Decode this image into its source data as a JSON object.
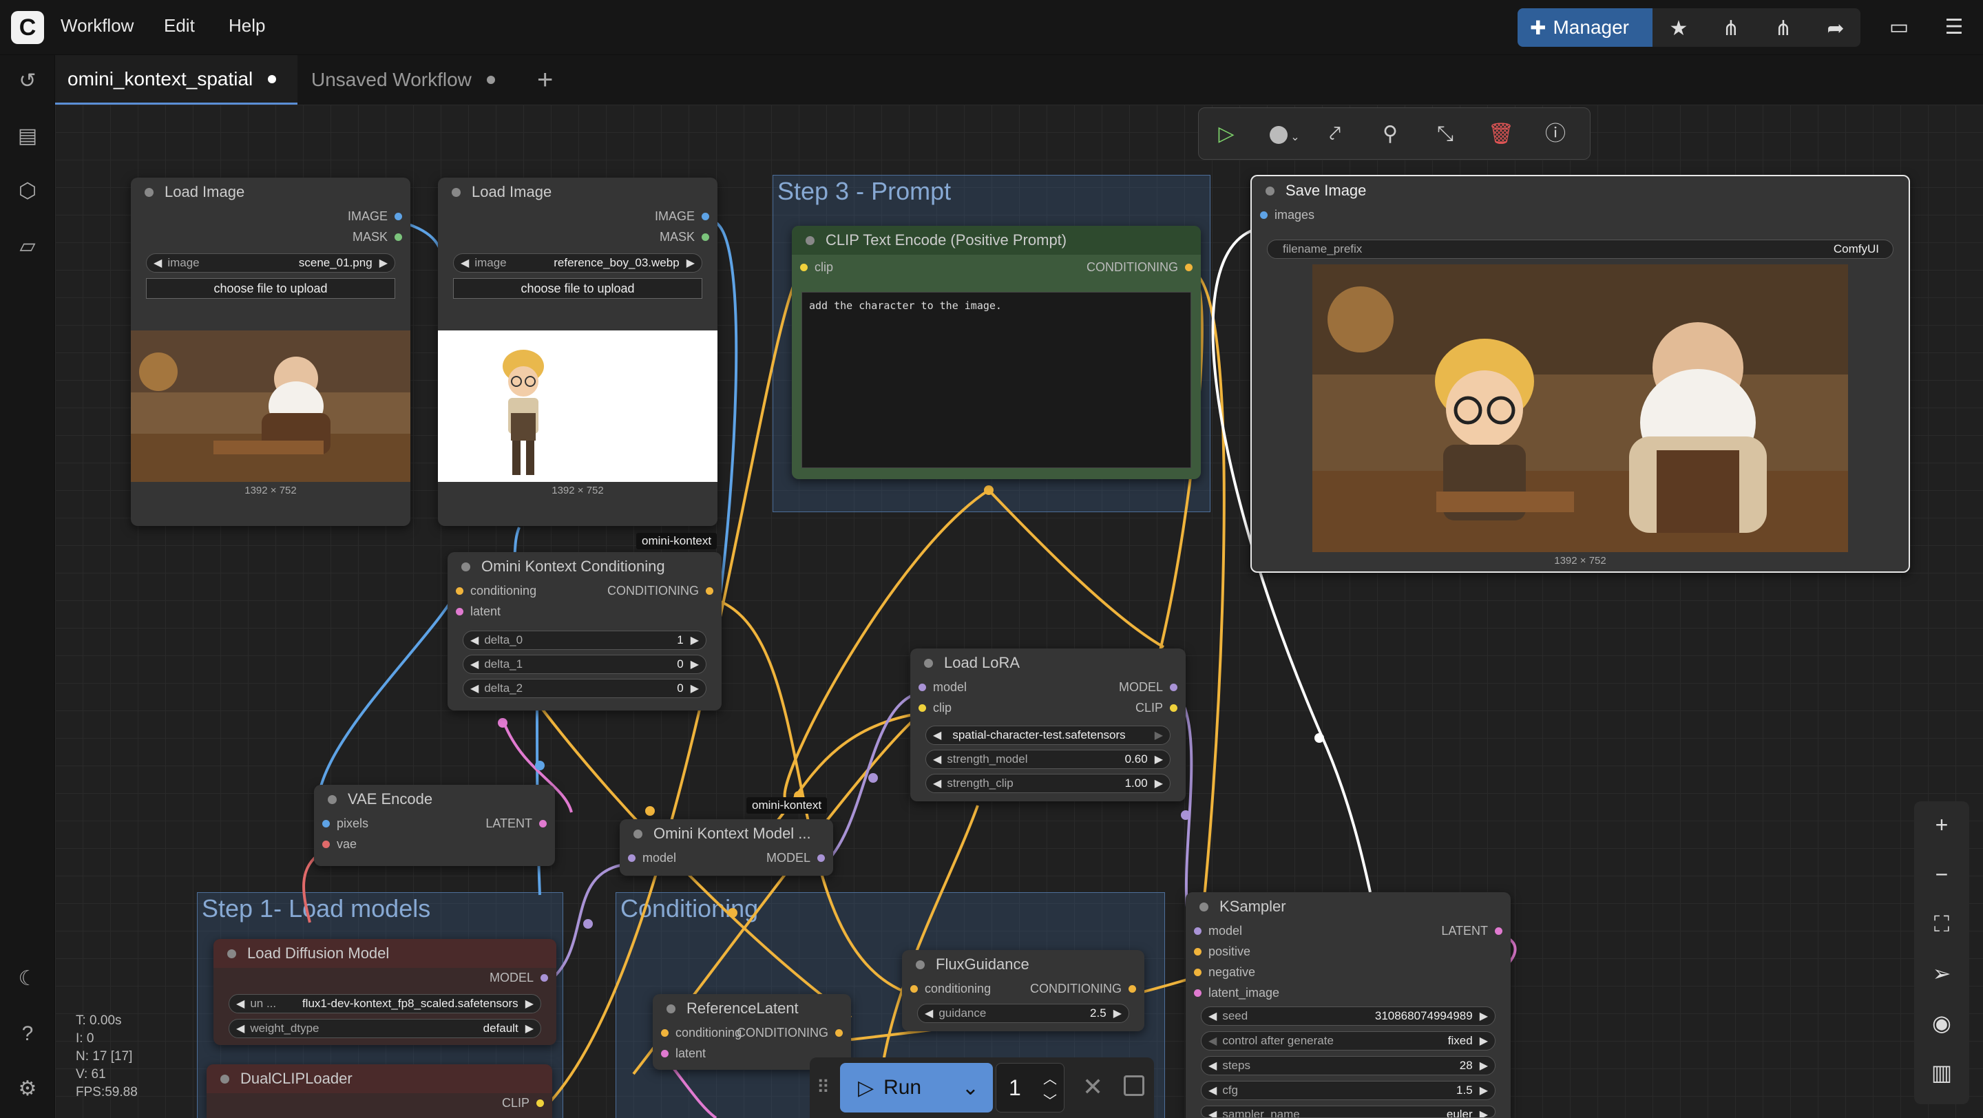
{
  "menu": {
    "workflow": "Workflow",
    "edit": "Edit",
    "help": "Help"
  },
  "toolbar": {
    "manager": "Manager"
  },
  "tabs": [
    {
      "label": "omini_kontext_spatial"
    },
    {
      "label": "Unsaved Workflow"
    }
  ],
  "groups": {
    "step3": "Step 3 - Prompt",
    "step1": "Step 1- Load models",
    "conditioning": "Conditioning"
  },
  "nodes": {
    "load_image_1": {
      "title": "Load Image",
      "out1": "IMAGE",
      "out2": "MASK",
      "widget_label": "image",
      "widget_value": "scene_01.png",
      "button": "choose file to upload",
      "dims": "1392 × 752"
    },
    "load_image_2": {
      "title": "Load Image",
      "out1": "IMAGE",
      "out2": "MASK",
      "widget_label": "image",
      "widget_value": "reference_boy_03.webp",
      "button": "choose file to upload",
      "dims": "1392 × 752"
    },
    "clip_text": {
      "title": "CLIP Text Encode (Positive Prompt)",
      "in1": "clip",
      "out1": "CONDITIONING",
      "prompt": "add the character to the image."
    },
    "save_image": {
      "title": "Save Image",
      "in1": "images",
      "widget_label": "filename_prefix",
      "widget_value": "ComfyUI",
      "dims": "1392 × 752"
    },
    "omini_cond": {
      "title": "Omini Kontext Conditioning",
      "tag": "omini-kontext",
      "in1": "conditioning",
      "in2": "latent",
      "out1": "CONDITIONING",
      "w1_label": "delta_0",
      "w1_value": "1",
      "w2_label": "delta_1",
      "w2_value": "0",
      "w3_label": "delta_2",
      "w3_value": "0"
    },
    "load_lora": {
      "title": "Load LoRA",
      "in1": "model",
      "in2": "clip",
      "out1": "MODEL",
      "out2": "CLIP",
      "w1_value": "spatial-character-test.safetensors",
      "w2_label": "strength_model",
      "w2_value": "0.60",
      "w3_label": "strength_clip",
      "w3_value": "1.00"
    },
    "vae_encode": {
      "title": "VAE Encode",
      "in1": "pixels",
      "in2": "vae",
      "out1": "LATENT"
    },
    "omini_model": {
      "title": "Omini Kontext Model ...",
      "tag": "omini-kontext",
      "in1": "model",
      "out1": "MODEL"
    },
    "load_diffusion": {
      "title": "Load Diffusion Model",
      "out1": "MODEL",
      "w1_label": "un ...",
      "w1_value": "flux1-dev-kontext_fp8_scaled.safetensors",
      "w2_label": "weight_dtype",
      "w2_value": "default"
    },
    "dual_clip": {
      "title": "DualCLIPLoader",
      "out1": "CLIP"
    },
    "flux_guidance": {
      "title": "FluxGuidance",
      "in1": "conditioning",
      "out1": "CONDITIONING",
      "w1_label": "guidance",
      "w1_value": "2.5"
    },
    "reference_latent": {
      "title": "ReferenceLatent",
      "in1": "conditioning",
      "in2": "latent",
      "out1": "CONDITIONING"
    },
    "ksampler": {
      "title": "KSampler",
      "in1": "model",
      "in2": "positive",
      "in3": "negative",
      "in4": "latent_image",
      "out1": "LATENT",
      "w1_label": "seed",
      "w1_value": "310868074994989",
      "w2_label": "control after generate",
      "w2_value": "fixed",
      "w3_label": "steps",
      "w3_value": "28",
      "w4_label": "cfg",
      "w4_value": "1.5",
      "w5_label": "sampler_name",
      "w5_value": "euler"
    }
  },
  "runbar": {
    "run": "Run",
    "count": "1"
  },
  "stats": {
    "t": "T: 0.00s",
    "i": "I: 0",
    "n": "N: 17 [17]",
    "v": "V: 61",
    "fps": "FPS:59.88"
  },
  "colors": {
    "accent": "#2f5f99",
    "wire_yellow": "#f0b43c",
    "wire_blue": "#5ea3e6",
    "wire_purple": "#a993d6",
    "wire_pink": "#e07ad0",
    "wire_red": "#e06a6a",
    "wire_white": "#ffffff"
  },
  "icons": [
    "puzzle-icon",
    "star-icon",
    "workflow-icon",
    "share-icon",
    "panel-icon",
    "hamburger-icon",
    "history-icon",
    "document-icon",
    "cube-icon",
    "folder-icon",
    "moon-icon",
    "help-icon",
    "gear-icon",
    "play-icon",
    "pin-icon",
    "trash-icon",
    "zoom-in-icon",
    "zoom-out-icon",
    "fit-view-icon",
    "eye-icon",
    "map-icon"
  ]
}
